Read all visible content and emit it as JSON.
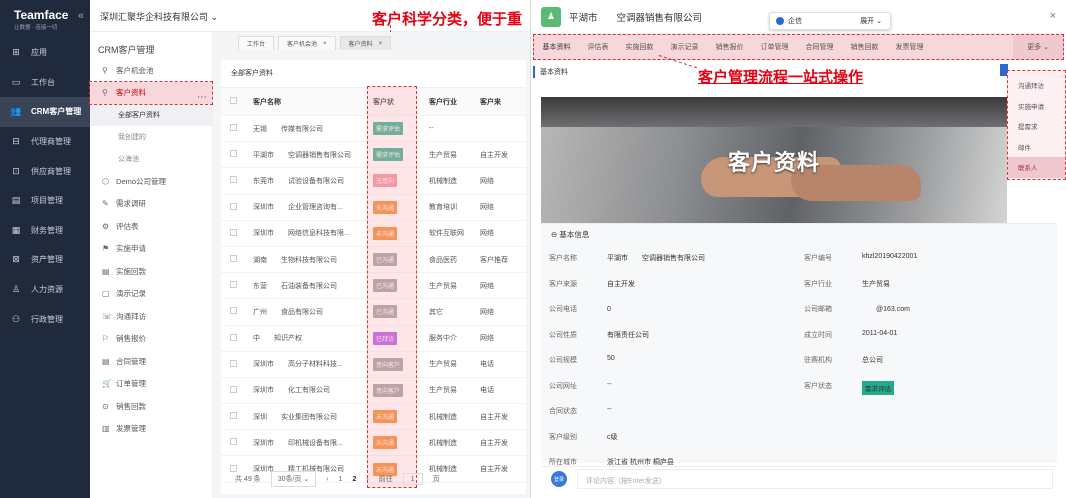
{
  "app": {
    "name": "Teamface",
    "tagline": "让数据 · 连接一切",
    "collapse": "«"
  },
  "nav": [
    {
      "label": "应用",
      "icon": "apps-icon",
      "glyph": "⊞"
    },
    {
      "label": "工作台",
      "icon": "workbench-icon",
      "glyph": "▭"
    },
    {
      "label": "CRM客户管理",
      "icon": "crm-icon",
      "glyph": "👥",
      "active": true
    },
    {
      "label": "代理商管理",
      "icon": "agent-icon",
      "glyph": "⊟"
    },
    {
      "label": "供应商管理",
      "icon": "supplier-icon",
      "glyph": "⊡"
    },
    {
      "label": "项目管理",
      "icon": "project-icon",
      "glyph": "▤"
    },
    {
      "label": "财务管理",
      "icon": "finance-icon",
      "glyph": "▦"
    },
    {
      "label": "资产管理",
      "icon": "asset-icon",
      "glyph": "⊠"
    },
    {
      "label": "人力资源",
      "icon": "hr-icon",
      "glyph": "♙"
    },
    {
      "label": "行政管理",
      "icon": "admin-icon",
      "glyph": "⚇"
    }
  ],
  "topbar": {
    "company": "深圳汇聚华企科技有限公司 ⌄",
    "headline": "客户科学分类，便于重点跟进"
  },
  "subnav": {
    "title": "CRM客户管理",
    "items": [
      {
        "label": "客户机会池",
        "glyph": "⚲"
      },
      {
        "label": "客户资料",
        "glyph": "⚲",
        "highlight": true
      },
      {
        "child": "全部客户资料",
        "sel": true
      },
      {
        "child": "我创建的"
      },
      {
        "child": "公海池"
      },
      {
        "label": "Demo公司管理",
        "glyph": "⬡"
      },
      {
        "label": "需求调研",
        "glyph": "✎"
      },
      {
        "label": "评估表",
        "glyph": "⚙"
      },
      {
        "label": "实施申请",
        "glyph": "⚑"
      },
      {
        "label": "实施回款",
        "glyph": "▤"
      },
      {
        "label": "演示记录",
        "glyph": "▢"
      },
      {
        "label": "沟通拜访",
        "glyph": "☏"
      },
      {
        "label": "销售报价",
        "glyph": "⚐"
      },
      {
        "label": "合同管理",
        "glyph": "▤"
      },
      {
        "label": "订单管理",
        "glyph": "🛒"
      },
      {
        "label": "销售回款",
        "glyph": "⊙"
      },
      {
        "label": "发票管理",
        "glyph": "▥"
      }
    ]
  },
  "tabs": [
    {
      "label": "工作台"
    },
    {
      "label": "客户机会池",
      "close": "×"
    },
    {
      "label": "客户资料",
      "active": true,
      "close": "×"
    }
  ],
  "list": {
    "title": "全部客户资料",
    "headers": [
      "客户名称",
      "客户状",
      "客户行业",
      "客户来"
    ],
    "rows": [
      {
        "name": "无锡　　传媒有限公司",
        "status": "需求评估",
        "color": "#2bab8a",
        "industry": "--",
        "source": ""
      },
      {
        "name": "平湖市　　空调器销售有限公司",
        "status": "需求评估",
        "color": "#2bab8a",
        "industry": "生产贸易",
        "source": "自主开发"
      },
      {
        "name": "东莞市　　试验设备有限公司",
        "status": "无意向",
        "color": "#f28b96",
        "industry": "机械制造",
        "source": "网络"
      },
      {
        "name": "深圳市　　企业管理咨询有...",
        "status": "未沟通",
        "color": "#f5821f",
        "industry": "教育培训",
        "source": "网络"
      },
      {
        "name": "深圳市　　网络信息科技有限...",
        "status": "未沟通",
        "color": "#f5821f",
        "industry": "软件互联网",
        "source": "网络"
      },
      {
        "name": "湖南　　生物科技有限公司",
        "status": "已沟通",
        "color": "#9a9a9a",
        "industry": "食品医药",
        "source": "客户推荐"
      },
      {
        "name": "东营　　石油装备有限公司",
        "status": "已沟通",
        "color": "#9a9a9a",
        "industry": "生产贸易",
        "source": "网络"
      },
      {
        "name": "广州　　食品有限公司",
        "status": "已沟通",
        "color": "#9a9a9a",
        "industry": "其它",
        "source": "网络"
      },
      {
        "name": "中　　知识产权",
        "status": "已拜访",
        "color": "#b04fe0",
        "industry": "服务中介",
        "source": "网络"
      },
      {
        "name": "深圳市　　高分子材料科技...",
        "status": "意向客户",
        "color": "#9a9a9a",
        "industry": "生产贸易",
        "source": "电话"
      },
      {
        "name": "深圳市　　化工有限公司",
        "status": "意向客户",
        "color": "#9a9a9a",
        "industry": "生产贸易",
        "source": "电话"
      },
      {
        "name": "深圳　　实业集团有限公司",
        "status": "未沟通",
        "color": "#f5821f",
        "industry": "机械制造",
        "source": "自主开发"
      },
      {
        "name": "深圳市　　印机械设备有限...",
        "status": "未沟通",
        "color": "#f5821f",
        "industry": "机械制造",
        "source": "自主开发"
      },
      {
        "name": "深圳市　　精工机械有限公司",
        "status": "未沟通",
        "color": "#f5821f",
        "industry": "机械制造",
        "source": "自主开发"
      }
    ],
    "pager": {
      "total": "共 49 条",
      "per": "30条/页 ⌄",
      "prev": "‹",
      "p1": "1",
      "p2": "2",
      "next": "›",
      "goto": "前往",
      "page": "1",
      "unit": "页"
    }
  },
  "detail": {
    "title": "平湖市　　空调器销售有限公司",
    "close": "×",
    "tabs": [
      "基本资料",
      "评估表",
      "实施回款",
      "演示记录",
      "销售报价",
      "订单管理",
      "合同管理",
      "销售回款",
      "发票管理"
    ],
    "more": "更多 ⌄",
    "more_items": [
      "沟通拜访",
      "实施申请",
      "提需求",
      "邮件",
      "联系人"
    ],
    "annotation": "客户管理流程一站式操作",
    "basic_tab": "基本资料",
    "banner": "客户资料",
    "section": "⊖  基本信息",
    "fields_left": [
      {
        "k": "客户名称",
        "v": "平湖市　　空调器销售有限公司"
      },
      {
        "k": "客户来源",
        "v": "自主开发"
      },
      {
        "k": "公司电话",
        "v": "0　　　　　"
      },
      {
        "k": "公司性质",
        "v": "有限责任公司"
      },
      {
        "k": "公司规模",
        "v": "50"
      },
      {
        "k": "公司网址",
        "v": "--"
      },
      {
        "k": "合同状态",
        "v": "--"
      },
      {
        "k": "客户级别",
        "v": "c级"
      },
      {
        "k": "所在城市",
        "v": "浙江省 杭州市 桐庐县"
      }
    ],
    "fields_right": [
      {
        "k": "客户编号",
        "v": "khzl20190422001"
      },
      {
        "k": "客户行业",
        "v": "生产贸易"
      },
      {
        "k": "公司邮箱",
        "v": "　　@163.com"
      },
      {
        "k": "成立时间",
        "v": "2011-04-01"
      },
      {
        "k": "驻赛机构",
        "v": "总公司"
      },
      {
        "k": "客户状态",
        "v": "需求评估"
      }
    ],
    "comment_placeholder": "评论内容（按Enter发送）",
    "avatar_label": "登录",
    "qixin": "企信",
    "expand": "展开 ⌄"
  }
}
